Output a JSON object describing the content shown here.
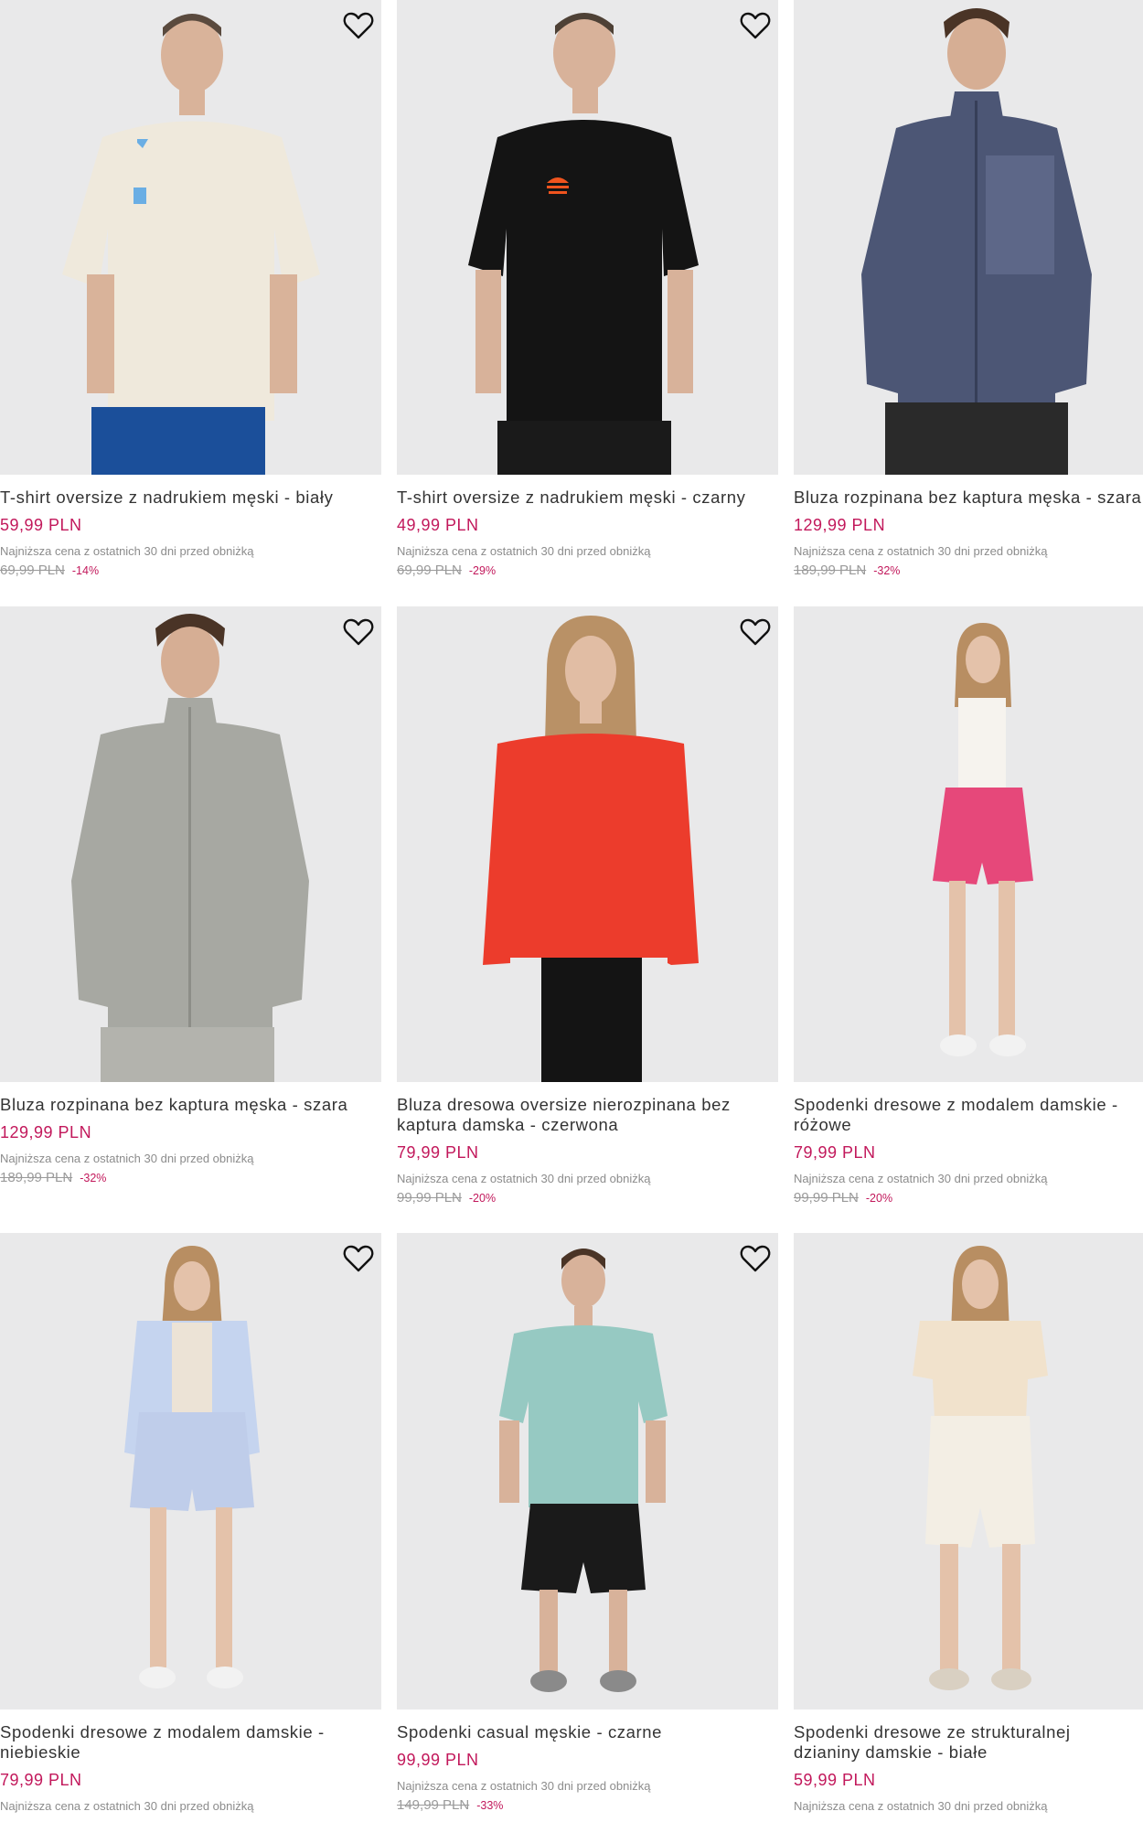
{
  "products": [
    {
      "title": "T-shirt oversize z nadrukiem męski - biały",
      "price": "59,99 PLN",
      "lowest_label": "Najniższa cena z ostatnich 30 dni przed obniżką",
      "old_price": "69,99 PLN",
      "discount": "-14%",
      "image": "man-cream-tshirt-blue-shorts",
      "colors": {
        "bg": "#e9e9ea",
        "top": "#efe9dc",
        "bottom": "#1b4f9a",
        "logo": "#6aaee4"
      }
    },
    {
      "title": "T-shirt oversize z nadrukiem męski - czarny",
      "price": "49,99 PLN",
      "lowest_label": "Najniższa cena z ostatnich 30 dni przed obniżką",
      "old_price": "69,99 PLN",
      "discount": "-29%",
      "image": "man-black-tshirt",
      "colors": {
        "bg": "#e9e9ea",
        "top": "#141414",
        "bottom": "#1a1a1a",
        "logo": "#f0541e"
      }
    },
    {
      "title": "Bluza rozpinana bez kaptura męska - szara",
      "price": "129,99 PLN",
      "lowest_label": "Najniższa cena z ostatnich 30 dni przed obniżką",
      "old_price": "189,99 PLN",
      "discount": "-32%",
      "image": "man-navy-zip-jacket",
      "colors": {
        "bg": "#e9e9ea",
        "top": "#4c5675",
        "bottom": "#2a2a2a",
        "logo": "#4c5675"
      }
    },
    {
      "title": "Bluza rozpinana bez kaptura męska - szara",
      "price": "129,99 PLN",
      "lowest_label": "Najniższa cena z ostatnich 30 dni przed obniżką",
      "old_price": "189,99 PLN",
      "discount": "-32%",
      "image": "man-grey-zip-jacket",
      "colors": {
        "bg": "#e9e9ea",
        "top": "#a7a8a2",
        "bottom": "#b3b3ad",
        "logo": "#a7a8a2"
      }
    },
    {
      "title": "Bluza dresowa oversize nierozpinana bez kaptura damska - czerwona",
      "price": "79,99 PLN",
      "lowest_label": "Najniższa cena z ostatnich 30 dni przed obniżką",
      "old_price": "99,99 PLN",
      "discount": "-20%",
      "image": "woman-red-sweatshirt",
      "colors": {
        "bg": "#e9e9ea",
        "top": "#ec3c2c",
        "bottom": "#141414",
        "logo": "#ec3c2c"
      }
    },
    {
      "title": "Spodenki dresowe z modalem damskie - różowe",
      "price": "79,99 PLN",
      "lowest_label": "Najniższa cena z ostatnich 30 dni przed obniżką",
      "old_price": "99,99 PLN",
      "discount": "-20%",
      "image": "woman-pink-shorts",
      "colors": {
        "bg": "#e9e9ea",
        "top": "#f6f3ee",
        "bottom": "#e6487a",
        "logo": "#e6487a"
      }
    },
    {
      "title": "Spodenki dresowe z modalem damskie - niebieskie",
      "price": "79,99 PLN",
      "lowest_label": "Najniższa cena z ostatnich 30 dni przed obniżką",
      "old_price": "",
      "discount": "",
      "image": "woman-light-blue-shorts",
      "colors": {
        "bg": "#e9e9ea",
        "top": "#c5d4ef",
        "bottom": "#bfcdea",
        "logo": "#ece3d6"
      }
    },
    {
      "title": "Spodenki casual męskie - czarne",
      "price": "99,99 PLN",
      "lowest_label": "Najniższa cena z ostatnich 30 dni przed obniżką",
      "old_price": "149,99 PLN",
      "discount": "-33%",
      "image": "man-mint-tshirt-black-shorts",
      "colors": {
        "bg": "#e9e9ea",
        "top": "#96c9c2",
        "bottom": "#1a1a1a",
        "logo": "#96c9c2"
      }
    },
    {
      "title": "Spodenki dresowe ze strukturalnej dzianiny damskie - białe",
      "price": "59,99 PLN",
      "lowest_label": "Najniższa cena z ostatnich 30 dni przed obniżką",
      "old_price": "",
      "discount": "",
      "image": "woman-cream-shorts",
      "colors": {
        "bg": "#e9e9ea",
        "top": "#f1e2cc",
        "bottom": "#f3eee4",
        "logo": "#f1e2cc"
      }
    }
  ]
}
